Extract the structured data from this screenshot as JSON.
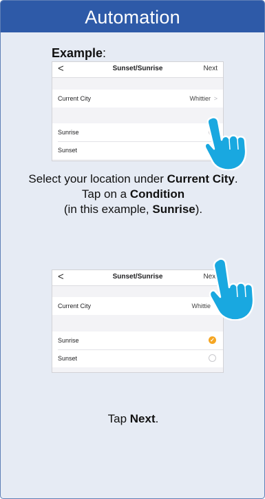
{
  "header": {
    "title": "Automation"
  },
  "example_label": "Example",
  "example_colon": ":",
  "screen1": {
    "back_glyph": "<",
    "nav_title": "Sunset/Sunrise",
    "nav_next": "Next",
    "current_city_label": "Current City",
    "current_city_value": "Whittier",
    "chevron": ">",
    "sunrise_label": "Sunrise",
    "sunset_label": "Sunset",
    "sunrise_checked": false,
    "sunset_checked": false
  },
  "instruction1": {
    "line1_pre": "Select your location under ",
    "line1_bold": "Current City",
    "line1_post": ".",
    "line2_pre": "Tap on a ",
    "line2_bold": "Condition",
    "line3_pre": "(in this example, ",
    "line3_bold": "Sunrise",
    "line3_post": ")."
  },
  "screen2": {
    "back_glyph": "<",
    "nav_title": "Sunset/Sunrise",
    "nav_next": "Next",
    "current_city_label": "Current City",
    "current_city_value": "Whittie",
    "sunrise_label": "Sunrise",
    "sunset_label": "Sunset",
    "check_glyph": "✓",
    "sunrise_checked": true,
    "sunset_checked": false
  },
  "instruction2": {
    "pre": "Tap ",
    "bold": "Next",
    "post": "."
  },
  "colors": {
    "banner": "#2e5aa8",
    "card_background": "#e6ebf4",
    "hand": "#19a8e0",
    "checked_radio": "#f5a623"
  },
  "icons": {
    "pointer": "pointing-hand-icon",
    "check": "checkmark-icon",
    "back": "back-chevron-icon",
    "disclosure": "chevron-right-icon"
  }
}
